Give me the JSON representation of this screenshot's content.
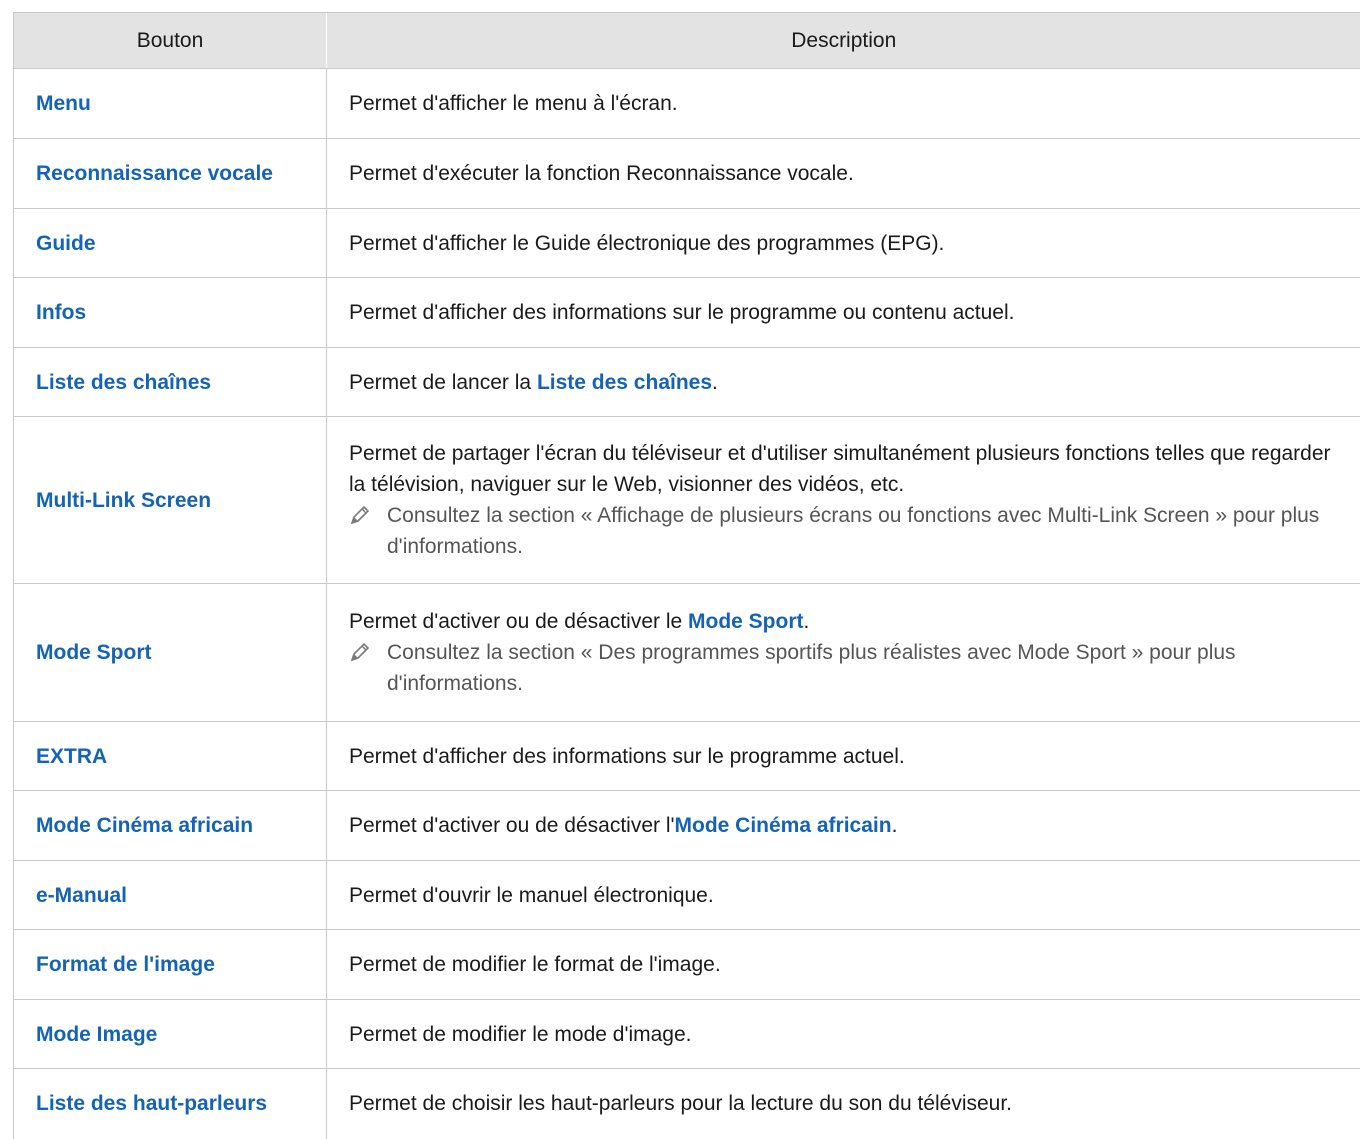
{
  "header": {
    "col_button": "Bouton",
    "col_description": "Description"
  },
  "rows": [
    {
      "button": "Menu",
      "desc": "Permet d'afficher le menu à l'écran."
    },
    {
      "button": "Reconnaissance vocale",
      "desc": "Permet d'exécuter la fonction Reconnaissance vocale."
    },
    {
      "button": "Guide",
      "desc": "Permet d'afficher le Guide électronique des programmes (EPG)."
    },
    {
      "button": "Infos",
      "desc": "Permet d'afficher des informations sur le programme ou contenu actuel."
    },
    {
      "button": "Liste des chaînes",
      "desc_pre": "Permet de lancer la ",
      "desc_em": "Liste des chaînes",
      "desc_post": "."
    },
    {
      "button": "Multi-Link Screen",
      "desc": "Permet de partager l'écran du téléviseur et d'utiliser simultanément plusieurs fonctions telles que regarder la télévision, naviguer sur le Web, visionner des vidéos, etc.",
      "note": "Consultez la section « Affichage de plusieurs écrans ou fonctions avec Multi-Link Screen » pour plus d'informations."
    },
    {
      "button": "Mode Sport",
      "desc_pre": "Permet d'activer ou de désactiver le ",
      "desc_em": "Mode Sport",
      "desc_post": ".",
      "note": "Consultez la section « Des programmes sportifs plus réalistes avec Mode Sport » pour plus d'informations."
    },
    {
      "button": "EXTRA",
      "desc": "Permet d'afficher des informations sur le programme actuel."
    },
    {
      "button": "Mode Cinéma africain",
      "desc_pre": "Permet d'activer ou de désactiver l'",
      "desc_em": "Mode Cinéma africain",
      "desc_post": "."
    },
    {
      "button": "e-Manual",
      "desc": "Permet d'ouvrir le manuel électronique."
    },
    {
      "button": "Format de l'image",
      "desc": "Permet de modifier le format de l'image."
    },
    {
      "button": "Mode Image",
      "desc": "Permet de modifier le mode d'image."
    },
    {
      "button": "Liste des haut-parleurs",
      "desc": "Permet de choisir les haut-parleurs pour la lecture du son du téléviseur."
    }
  ],
  "icons": {
    "note": "pencil-icon"
  },
  "colors": {
    "accent": "#1563b4",
    "header_bg": "#e3e3e3",
    "note_text": "#555555",
    "border": "#c8c8c8"
  }
}
